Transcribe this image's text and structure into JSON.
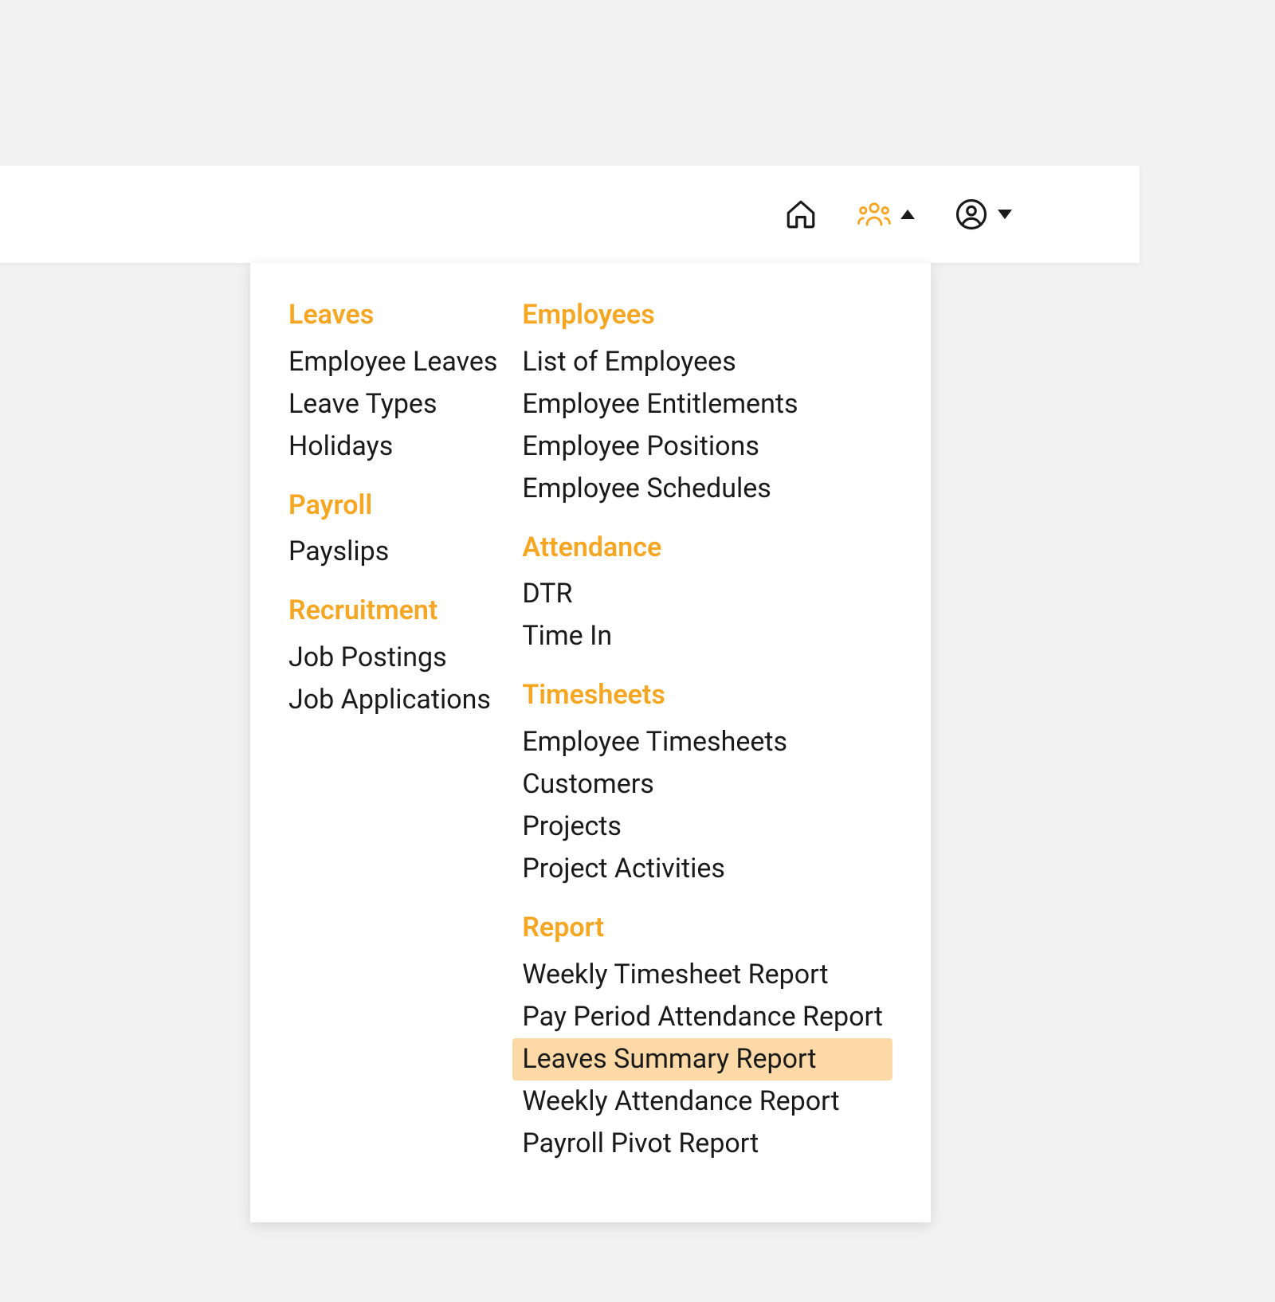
{
  "header": {
    "home_icon": "home",
    "hr_icon": "people",
    "user_icon": "user"
  },
  "menu": {
    "left": [
      {
        "heading": "Leaves",
        "items": [
          "Employee Leaves",
          "Leave Types",
          "Holidays"
        ]
      },
      {
        "heading": "Payroll",
        "items": [
          "Payslips"
        ]
      },
      {
        "heading": "Recruitment",
        "items": [
          "Job Postings",
          "Job Applications"
        ]
      }
    ],
    "right": [
      {
        "heading": "Employees",
        "items": [
          "List of Employees",
          "Employee Entitlements",
          "Employee Positions",
          "Employee Schedules"
        ]
      },
      {
        "heading": "Attendance",
        "items": [
          "DTR",
          "Time In"
        ]
      },
      {
        "heading": "Timesheets",
        "items": [
          "Employee Timesheets",
          "Customers",
          "Projects",
          "Project Activities"
        ]
      },
      {
        "heading": "Report",
        "items": [
          "Weekly Timesheet Report",
          "Pay Period Attendance Report",
          "Leaves Summary Report",
          "Weekly Attendance Report",
          "Payroll Pivot Report"
        ]
      }
    ],
    "highlighted": "Leaves Summary Report"
  }
}
